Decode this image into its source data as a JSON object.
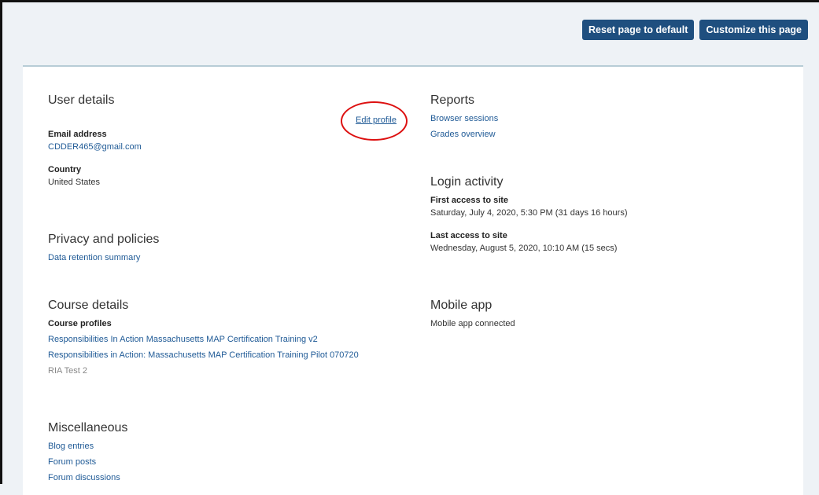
{
  "header": {
    "reset_label": "Reset page to default",
    "customize_label": "Customize this page"
  },
  "user_details": {
    "heading": "User details",
    "edit_profile": "Edit profile",
    "email_label": "Email address",
    "email_value": "CDDER465@gmail.com",
    "country_label": "Country",
    "country_value": "United States"
  },
  "privacy": {
    "heading": "Privacy and policies",
    "link": "Data retention summary"
  },
  "course_details": {
    "heading": "Course details",
    "profiles_label": "Course profiles",
    "courses": [
      "Responsibilities In Action Massachusetts MAP Certification Training v2",
      "Responsibilities in Action: Massachusetts MAP Certification Training Pilot 070720",
      "RIA Test 2"
    ]
  },
  "misc": {
    "heading": "Miscellaneous",
    "links": [
      "Blog entries",
      "Forum posts",
      "Forum discussions"
    ]
  },
  "reports": {
    "heading": "Reports",
    "links": [
      "Browser sessions",
      "Grades overview"
    ]
  },
  "login": {
    "heading": "Login activity",
    "first_label": "First access to site",
    "first_value": "Saturday, July 4, 2020, 5:30 PM  (31 days 16 hours)",
    "last_label": "Last access to site",
    "last_value": "Wednesday, August 5, 2020, 10:10 AM  (15 secs)"
  },
  "mobile": {
    "heading": "Mobile app",
    "status": "Mobile app connected"
  }
}
